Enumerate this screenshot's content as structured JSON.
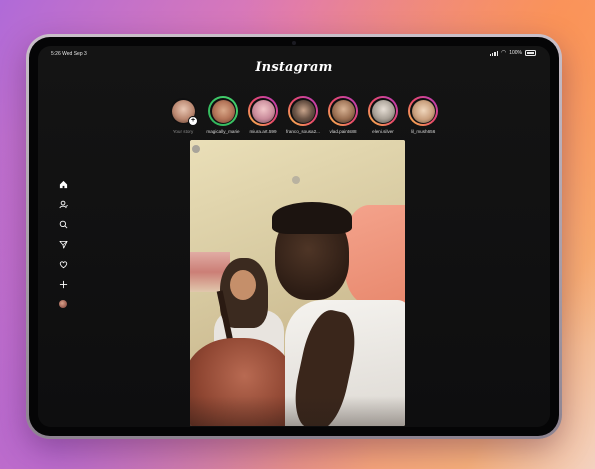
{
  "status_bar": {
    "time_date": "5:26  Wed Sep 3",
    "battery": "100%"
  },
  "app": {
    "title": "Instagram"
  },
  "stories": [
    {
      "name": "Your story",
      "ring": "none",
      "is_own": true,
      "add_symbol": "+"
    },
    {
      "name": "magically_marie",
      "ring": "green"
    },
    {
      "name": "miura.art.599",
      "ring": "gradient"
    },
    {
      "name": "franco_sousa2...",
      "ring": "gradient"
    },
    {
      "name": "vlad.paints88",
      "ring": "gradient"
    },
    {
      "name": "eleni.silver",
      "ring": "gradient"
    },
    {
      "name": "lil_mush656",
      "ring": "gradient"
    }
  ],
  "sidebar": [
    {
      "icon": "home-icon"
    },
    {
      "icon": "profile-icon"
    },
    {
      "icon": "search-icon"
    },
    {
      "icon": "direct-message-icon"
    },
    {
      "icon": "heart-icon"
    },
    {
      "icon": "plus-icon"
    },
    {
      "icon": "avatar"
    }
  ],
  "colors": {
    "screen_bg": "#0f0f10",
    "story_ring_gradient": [
      "#f9c24a",
      "#e84a6a",
      "#b43bc2"
    ],
    "close_friends_ring": "#2fb35a",
    "text": "#ffffff"
  }
}
